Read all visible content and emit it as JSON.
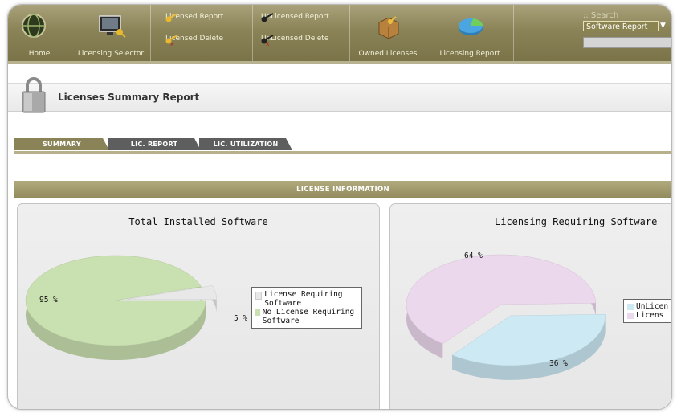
{
  "nav": {
    "home": "Home",
    "licensing_selector": "Licensing Selector",
    "licensed_report": "Licensed Report",
    "licensed_delete": "Licensed Delete",
    "unlicensed_report": "UnLicensed Report",
    "unlicensed_delete": "UnLicensed Delete",
    "owned_licenses": "Owned Licenses",
    "licensing_report": "Licensing Report"
  },
  "search": {
    "label": ":: Search",
    "selected": "Software Report",
    "value": ""
  },
  "page": {
    "title": "Licenses Summary Report"
  },
  "tabs": [
    {
      "label": "SUMMARY",
      "active": true
    },
    {
      "label": "LIC. REPORT",
      "active": false
    },
    {
      "label": "LIC. UTILIZATION",
      "active": false
    }
  ],
  "section": {
    "title": "LICENSE INFORMATION"
  },
  "colors": {
    "header": "#8a8358",
    "tab_active": "#8a8358",
    "tab_inactive": "#5c5c5c",
    "green": "#c9e0b0",
    "gray": "#e8e8e8",
    "pink": "#ecd8ec",
    "blue": "#cce9f4"
  },
  "charts": {
    "left_title": "Total Installed Software",
    "left_label_big": "95 %",
    "left_label_small": "5 %",
    "legend_left": [
      "License Requiring Software",
      "No License Requiring Software"
    ],
    "right_title": "Licensing Requiring Software",
    "right_label_big": "64 %",
    "right_label_small": "36 %",
    "legend_right": [
      "UnLicen",
      "Licens"
    ]
  },
  "chart_data": [
    {
      "type": "pie",
      "title": "Total Installed Software",
      "categories": [
        "No License Requiring Software",
        "License Requiring Software"
      ],
      "values": [
        95,
        5
      ],
      "legend": "right"
    },
    {
      "type": "pie",
      "title": "Licensing Requiring Software",
      "categories": [
        "Licensed",
        "UnLicensed"
      ],
      "values": [
        64,
        36
      ],
      "legend": "right"
    }
  ]
}
